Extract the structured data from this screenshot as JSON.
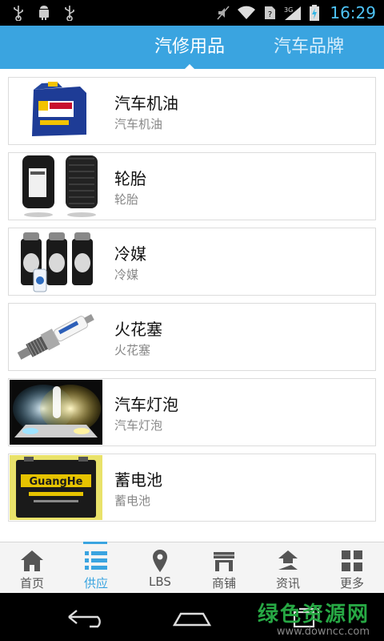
{
  "status_bar": {
    "time": "16:29",
    "icons": [
      "usb-icon",
      "android-debug-icon",
      "usb-icon",
      "mute-icon",
      "wifi-icon",
      "sim-icon",
      "signal-3g-icon",
      "battery-charging-icon"
    ]
  },
  "header": {
    "tabs": [
      {
        "label": "汽修用品",
        "active": true
      },
      {
        "label": "汽车品牌",
        "active": false
      }
    ]
  },
  "items": [
    {
      "title": "汽车机油",
      "subtitle": "汽车机油",
      "image": "engine-oil-image"
    },
    {
      "title": "轮胎",
      "subtitle": "轮胎",
      "image": "tires-image"
    },
    {
      "title": "冷媒",
      "subtitle": "冷媒",
      "image": "refrigerant-image"
    },
    {
      "title": "火花塞",
      "subtitle": "火花塞",
      "image": "spark-plug-image"
    },
    {
      "title": "汽车灯泡",
      "subtitle": "汽车灯泡",
      "image": "car-bulb-image"
    },
    {
      "title": "蓄电池",
      "subtitle": "蓄电池",
      "image": "battery-image",
      "image_brand": "GuangHe"
    }
  ],
  "bottom_nav": [
    {
      "label": "首页",
      "icon": "home-icon",
      "active": false
    },
    {
      "label": "供应",
      "icon": "list-icon",
      "active": true
    },
    {
      "label": "LBS",
      "icon": "location-pin-icon",
      "active": false
    },
    {
      "label": "商铺",
      "icon": "shop-icon",
      "active": false
    },
    {
      "label": "资讯",
      "icon": "news-icon",
      "active": false
    },
    {
      "label": "更多",
      "icon": "grid-icon",
      "active": false
    }
  ],
  "watermark": {
    "line1": "绿色资源网",
    "line2": "www.downcc.com"
  },
  "colors": {
    "accent": "#3aa4e0",
    "header_bg": "#3aa4e0",
    "watermark": "#27a844"
  }
}
